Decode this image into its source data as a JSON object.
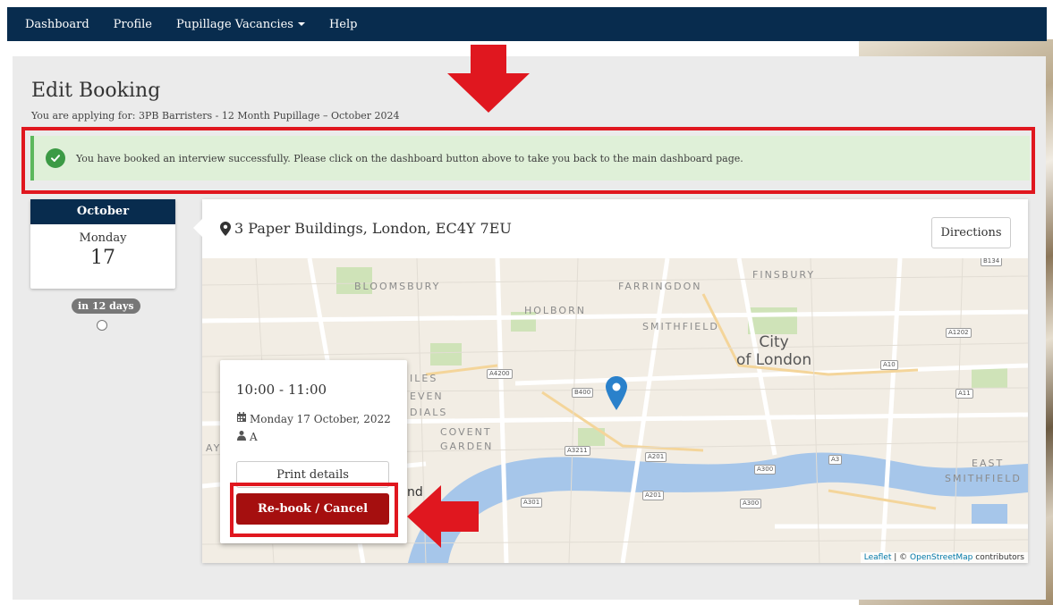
{
  "nav": {
    "items": [
      {
        "label": "Dashboard"
      },
      {
        "label": "Profile"
      },
      {
        "label": "Pupillage Vacancies"
      },
      {
        "label": "Help"
      }
    ]
  },
  "page": {
    "title": "Edit Booking",
    "subtitle": "You are applying for: 3PB Barristers - 12 Month Pupillage – October 2024"
  },
  "alert": {
    "message": "You have booked an interview successfully. Please click on the dashboard button above to take you back to the main dashboard page.",
    "icon": "check-circle-icon",
    "color": "#dff0d8"
  },
  "date_card": {
    "month": "October",
    "weekday": "Monday",
    "day": "17",
    "countdown": "in 12 days"
  },
  "location": {
    "address": "3 Paper Buildings, London, EC4Y 7EU",
    "directions_label": "Directions"
  },
  "map": {
    "labels": [
      "BLOOMSBURY",
      "FARRINGDON",
      "FINSBURY",
      "HOLBORN",
      "SMITHFIELD",
      "ILES",
      "EVEN",
      "DIALS",
      "COVENT",
      "GARDEN",
      "EAST",
      "SMITHFIELD",
      "nd",
      "AY"
    ],
    "city_label_line1": "City",
    "city_label_line2": "of London",
    "road_badges": [
      "A4200",
      "B400",
      "A3211",
      "A201",
      "A201",
      "A301",
      "A300",
      "A300",
      "A3",
      "A11",
      "A10",
      "A1202",
      "B134"
    ],
    "attribution_leaflet": "Leaflet",
    "attribution_sep": " | © ",
    "attribution_osm": "OpenStreetMap",
    "attribution_rest": " contributors"
  },
  "popup": {
    "time": "10:00 - 11:00",
    "date": "Monday 17 October, 2022",
    "room": "A",
    "print_label": "Print details",
    "rebook_label": "Re-book / Cancel"
  },
  "colors": {
    "nav_bg": "#082c4e",
    "highlight": "#e0171f",
    "rebook_bg": "#a50f0f"
  }
}
